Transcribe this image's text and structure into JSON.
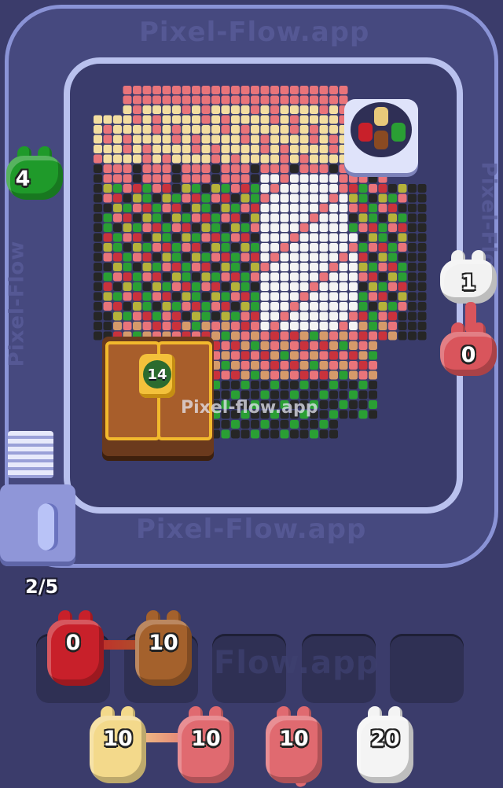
{
  "watermarks": {
    "track_top": "Pixel-Flow.app",
    "track_bottom": "Pixel-Flow.app",
    "center": "Pixel-flow.app",
    "track_left": "Pixel-Flow",
    "track_right": "Pixel-Flow",
    "slots": "Flow.app"
  },
  "crate": {
    "lock_count": "14"
  },
  "queue": {
    "counter": "2/5"
  },
  "conveyor_shooters": [
    {
      "name": "green-bunny",
      "color": "#1f9a2a",
      "count": "4"
    },
    {
      "name": "white-bunny",
      "color": "#f2f2f2",
      "count": "1"
    },
    {
      "name": "pink-bunny",
      "color": "#d9555c",
      "count": "0"
    }
  ],
  "slot_shooters": [
    {
      "name": "red-bunny",
      "color": "#c8202a",
      "count": "0"
    },
    {
      "name": "brown-bunny",
      "color": "#a4612c",
      "count": "10"
    }
  ],
  "waiting_shooters": [
    {
      "name": "cream-bunny",
      "color": "#f3d98b",
      "count": "10"
    },
    {
      "name": "pink-bunny-1",
      "color": "#e06a70",
      "count": "10"
    },
    {
      "name": "pink-bunny-2",
      "color": "#e06a70",
      "count": "10"
    },
    {
      "name": "white-bunny",
      "color": "#f4f4f4",
      "count": "20"
    }
  ],
  "colors": {
    "background": "#3b3c6b",
    "track": "#46497f",
    "board": "#3a3c6c",
    "pixel_cream": "#f3dea0",
    "pixel_pink": "#e9747a",
    "pixel_red": "#c9323c",
    "pixel_green": "#2a9f34",
    "pixel_white": "#f4f4f4",
    "pixel_black": "#262626",
    "pixel_olive": "#b5b23a",
    "pixel_tan": "#d59a6a"
  },
  "icons": [
    "bunny-shooter-icon",
    "lock-icon",
    "crate-icon",
    "spawner-icon",
    "chevron-icon"
  ]
}
